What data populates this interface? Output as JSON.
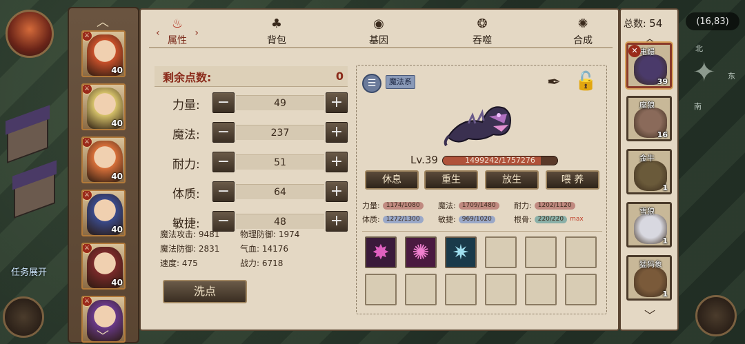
{
  "map": {
    "coordinates": "(16,83)",
    "compass": {
      "north": "北",
      "east": "东",
      "south": "南"
    },
    "mission_label": "任务展开"
  },
  "tabs": [
    {
      "label": "属性",
      "icon": "flame-icon",
      "active": true
    },
    {
      "label": "背包",
      "icon": "bag-icon",
      "active": false
    },
    {
      "label": "基因",
      "icon": "eye-icon",
      "active": false
    },
    {
      "label": "吞噬",
      "icon": "devour-icon",
      "active": false
    },
    {
      "label": "合成",
      "icon": "fusion-icon",
      "active": false
    }
  ],
  "heroes": [
    {
      "level": "40",
      "color": "#c8502a"
    },
    {
      "level": "40",
      "color": "#d6c26a"
    },
    {
      "level": "40",
      "color": "#d8703a"
    },
    {
      "level": "40",
      "color": "#3a4a8a"
    },
    {
      "level": "40",
      "color": "#7a2a2a"
    },
    {
      "level": "",
      "color": "#6a3a8a"
    }
  ],
  "stats": {
    "remaining_label": "剩余点数:",
    "remaining_value": "0",
    "rows": [
      {
        "label": "力量:",
        "value": "49"
      },
      {
        "label": "魔法:",
        "value": "237"
      },
      {
        "label": "耐力:",
        "value": "51"
      },
      {
        "label": "体质:",
        "value": "64"
      },
      {
        "label": "敏捷:",
        "value": "48"
      }
    ],
    "minus": "−",
    "plus": "+",
    "derived": [
      {
        "text": "魔法攻击: 9481"
      },
      {
        "text": "物理防御: 1974"
      },
      {
        "text": "魔法防御: 2831"
      },
      {
        "text": "气血: 14176"
      },
      {
        "text": "速度: 475"
      },
      {
        "text": "战力: 6718"
      }
    ],
    "reset_label": "洗点"
  },
  "pet": {
    "list_icon": "☰",
    "element": "魔法系",
    "level": "Lv.39",
    "exp_text": "1499242/1757276",
    "exp_fraction": 0.853,
    "actions": [
      "休息",
      "重生",
      "放生",
      "喂 养"
    ],
    "attributes": [
      {
        "label": "力量:",
        "value": "1174/1080",
        "color": "#c08a80"
      },
      {
        "label": "魔法:",
        "value": "1709/1480",
        "color": "#c08a80"
      },
      {
        "label": "耐力:",
        "value": "1202/1120",
        "color": "#c08a80"
      },
      {
        "label": "体质:",
        "value": "1272/1300",
        "color": "#9aa8c8"
      },
      {
        "label": "敏捷:",
        "value": "969/1020",
        "color": "#9aa8c8"
      },
      {
        "label": "根骨:",
        "value": "220/220",
        "color": "#8ab0a8",
        "max": "max"
      }
    ],
    "skills": [
      {
        "icon": "✸",
        "color": "#e060c0",
        "bg": "#3a1a3a"
      },
      {
        "icon": "✺",
        "color": "#f080d0",
        "bg": "#4a1a40"
      },
      {
        "icon": "✷",
        "color": "#a0e0f0",
        "bg": "#1a3a4a"
      }
    ]
  },
  "pet_list": {
    "total_label": "总数:",
    "total_value": "54",
    "items": [
      {
        "name": "电鳗",
        "level": "39",
        "color": "#4a3a6a",
        "selected": true
      },
      {
        "name": "座狼",
        "level": "16",
        "color": "#8a6a5a",
        "selected": false
      },
      {
        "name": "金牛",
        "level": "1",
        "color": "#6a5a3a",
        "selected": false
      },
      {
        "name": "雪狼",
        "level": "1",
        "color": "#d8d8e0",
        "selected": false
      },
      {
        "name": "猛犸象",
        "level": "1",
        "color": "#7a5a3a",
        "selected": false
      }
    ]
  }
}
